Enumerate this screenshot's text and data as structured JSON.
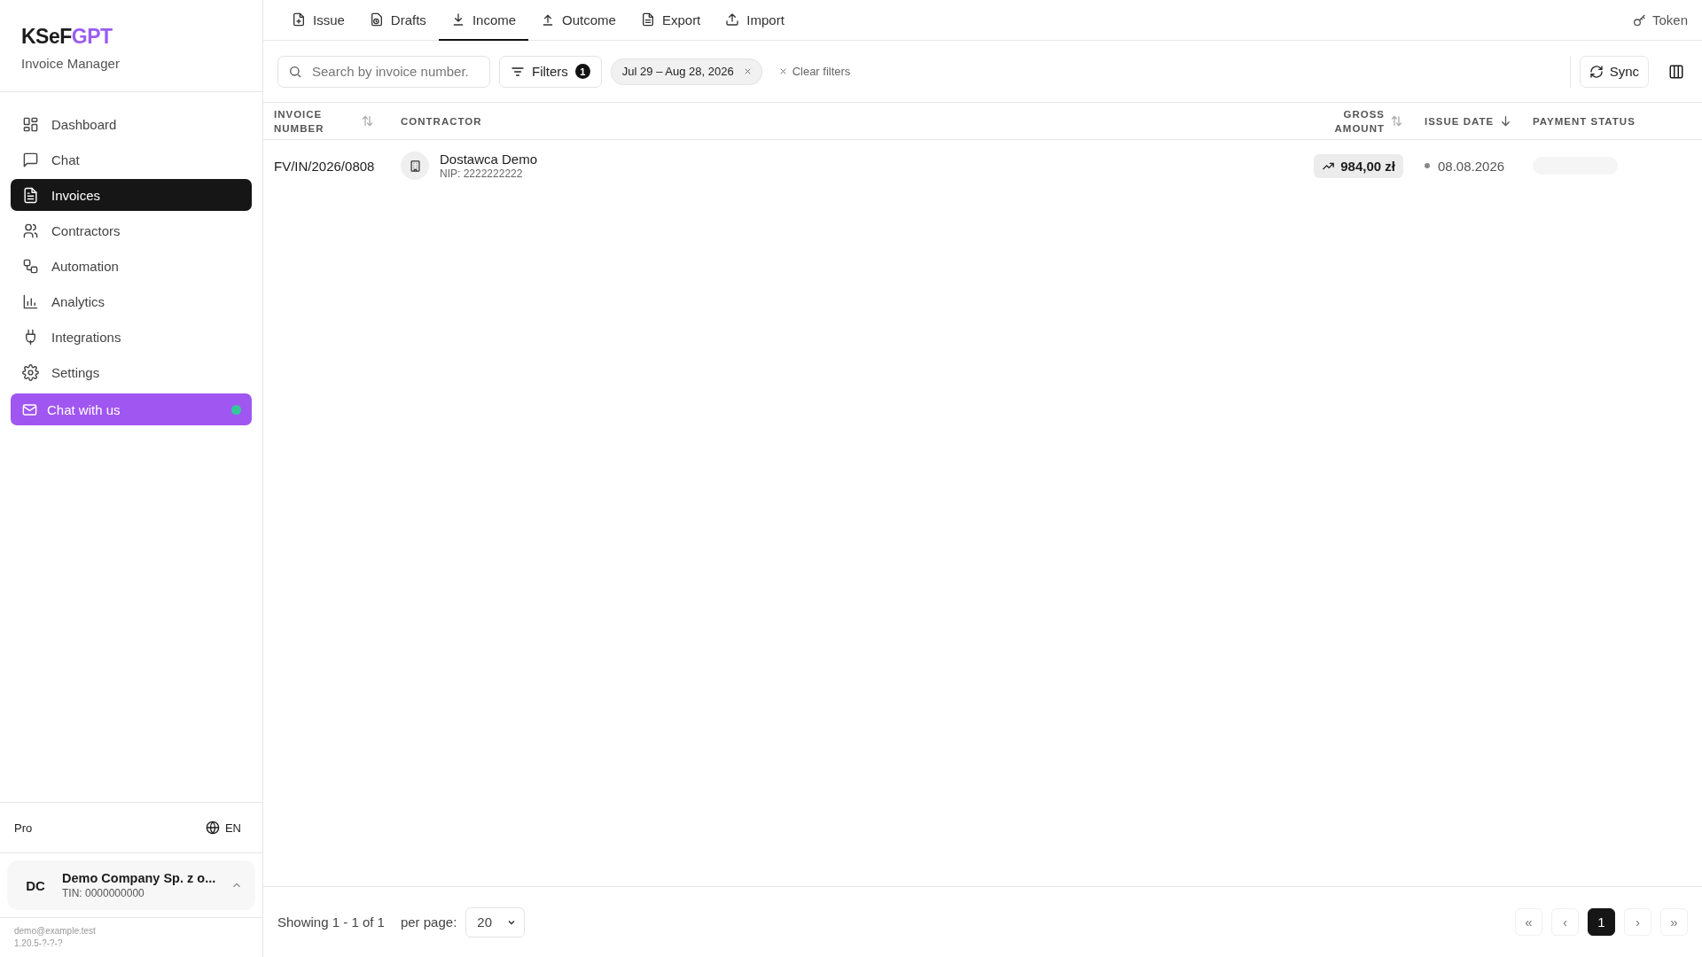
{
  "brand": {
    "name_main": "KSeF",
    "name_accent": "GPT",
    "subtitle": "Invoice Manager"
  },
  "sidebar": {
    "items": [
      {
        "label": "Dashboard",
        "selected": false
      },
      {
        "label": "Chat",
        "selected": false
      },
      {
        "label": "Invoices",
        "selected": true
      },
      {
        "label": "Contractors",
        "selected": false
      },
      {
        "label": "Automation",
        "selected": false
      },
      {
        "label": "Analytics",
        "selected": false
      },
      {
        "label": "Integrations",
        "selected": false
      },
      {
        "label": "Settings",
        "selected": false
      }
    ],
    "chat_button": {
      "label": "Chat with us",
      "online": true
    },
    "plan": "Pro",
    "language": "EN",
    "company": {
      "initials": "DC",
      "name": "Demo Company Sp. z o...",
      "tin": "TIN: 0000000000"
    },
    "email": "demo@example.test",
    "version": "1.20.5-?-?-?"
  },
  "tabs": [
    {
      "label": "Issue",
      "selected": false
    },
    {
      "label": "Drafts",
      "selected": false
    },
    {
      "label": "Income",
      "selected": true
    },
    {
      "label": "Outcome",
      "selected": false
    },
    {
      "label": "Export",
      "selected": false
    },
    {
      "label": "Import",
      "selected": false
    }
  ],
  "token_button": "Token",
  "toolbar": {
    "search": {
      "placeholder": "Search by invoice number."
    },
    "filters": {
      "label": "Filters",
      "count": "1"
    },
    "chip": "Jul 29 – Aug 28, 2026",
    "clear": "Clear filters",
    "sync": "Sync"
  },
  "table": {
    "columns": [
      {
        "label": "INVOICE NUMBER",
        "sortable": true,
        "sorted": false
      },
      {
        "label": "CONTRACTOR",
        "sortable": false,
        "sorted": false
      },
      {
        "label": "GROSS AMOUNT",
        "sortable": true,
        "sorted": false
      },
      {
        "label": "ISSUE DATE",
        "sortable": true,
        "sorted": true
      },
      {
        "label": "PAYMENT STATUS",
        "sortable": false,
        "sorted": false
      }
    ],
    "rows": [
      {
        "invoice_number": "FV/IN/2026/0808",
        "contractor": "Dostawca Demo",
        "nip": "NIP: 2222222222",
        "gross_amount": "984,00 zł",
        "issue_date": "08.08.2026",
        "payment_status": {
          "kind": "loading"
        }
      }
    ]
  },
  "footer": {
    "showing": "Showing 1 - 1 of 1",
    "per_page_label": "per page:",
    "per_page": "20",
    "pages": [
      {
        "label": "«",
        "selected": false
      },
      {
        "label": "‹",
        "selected": false
      },
      {
        "label": "1",
        "selected": true
      },
      {
        "label": "›",
        "selected": false
      },
      {
        "label": "»",
        "selected": false
      }
    ]
  }
}
